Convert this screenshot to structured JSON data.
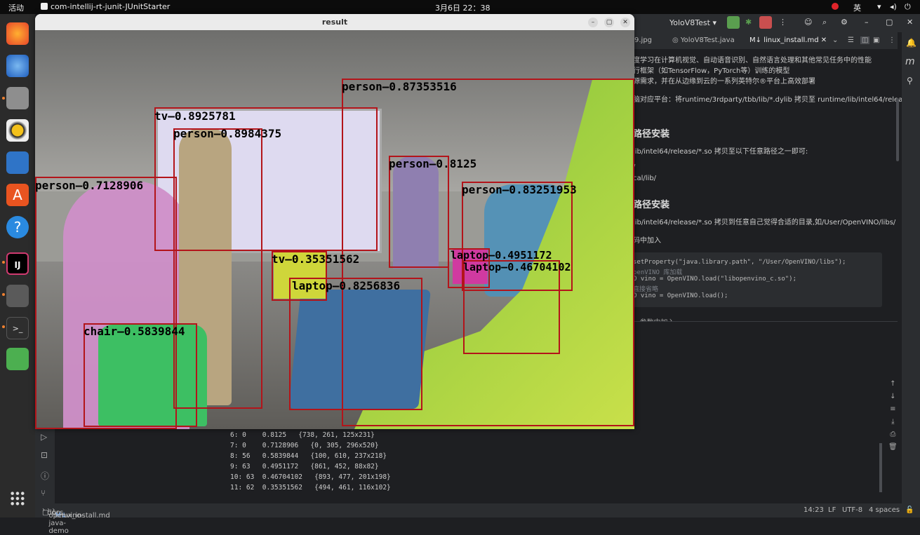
{
  "os": {
    "activities": "活动",
    "app_name": "com-intellij-rt-junit-JUnitStarter",
    "clock": "3月6日  22：38",
    "ime": "英"
  },
  "window": {
    "title": "result",
    "minimize": "–",
    "maximize": "▢",
    "close": "✕"
  },
  "detections": [
    {
      "label": "person–0.87353516"
    },
    {
      "label": "tv–0.8925781"
    },
    {
      "label": "person–0.8984375"
    },
    {
      "label": "person–0.8125"
    },
    {
      "label": "person–0.83251953"
    },
    {
      "label": "person–0.7128906"
    },
    {
      "label": "tv–0.35351562"
    },
    {
      "label": "laptop–0.4951172"
    },
    {
      "label": "laptop–0.46704102"
    },
    {
      "label": "laptop–0.8256836"
    },
    {
      "label": "chair–0.5839844"
    }
  ],
  "ide": {
    "run_config": "YoloV8Test",
    "tabs": [
      "9.jpg",
      "YoloV8Test.java",
      "linux_install.md"
    ],
    "editor_lines": [
      "度学习在计算机视觉、自动语音识别、自然语言处理和其他常见任务中的性能",
      "行框架（如TensorFlow，PyTorch等）训练的模型",
      "源需求，并在从边缘到云的一系列英特尔®平台上高效部署",
      "脑对应平台：将runtime/3rdparty/tbb/lib/*.dylib 拷贝至 runtime/lib/intel64/release/"
    ],
    "heading1": "路径安装",
    "section1_lines": [
      "lib/intel64/release/*.so 拷贝至以下任意路径之一即可:",
      "/",
      "cal/lib/"
    ],
    "heading2": "路径安装",
    "section2_lines": [
      "lib/intel64/release/*.so 拷贝到任意自己觉得合适的目录,如/User/OpenVINO/libs/",
      "码中加入"
    ],
    "code_lines": [
      "setProperty(\"java.library.path\", \"/User/OpenVINO/libs\");",
      "penVINO 库加载",
      "O vino = OpenVINO.load(\"libopenvino_c.so\");",
      "直接省略",
      "O vino = OpenVINO.load();"
    ],
    "trailing_line": "...参数中加入"
  },
  "console": [
    "6: 0    0.8125   {738, 261, 125x231}",
    "7: 0    0.7128906   {0, 305, 296x520}",
    "8: 56   0.5839844   {100, 610, 237x218}",
    "9: 63   0.4951172   {861, 452, 88x82}",
    "10: 63  0.46704102   {893, 477, 201x198}",
    "11: 62  0.35351562   {494, 461, 116x102}"
  ],
  "status": {
    "breadcrumb": [
      "openvino-java-demo",
      "docs",
      "cn",
      "linux_install.md"
    ],
    "position": "14:23",
    "line_sep": "LF",
    "encoding": "UTF-8",
    "indent": "4 spaces"
  }
}
